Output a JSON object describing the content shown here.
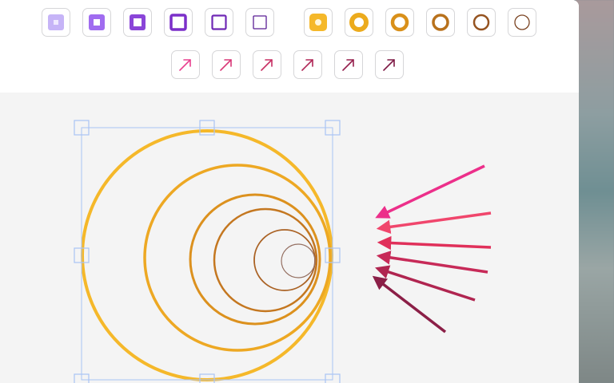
{
  "toolbar": {
    "square_tools": [
      {
        "name": "square-stroke-1",
        "fill": "#c6b4f7",
        "inner": "#efe9ff",
        "stroke_weight": 1
      },
      {
        "name": "square-stroke-2",
        "fill": "#a06cf0",
        "inner": "#ffffff",
        "stroke_weight": 2
      },
      {
        "name": "square-stroke-3",
        "fill": "#8a45d8",
        "inner": "#ffffff",
        "stroke_weight": 3
      },
      {
        "name": "square-stroke-4",
        "fill": "#7b2fc9",
        "inner": "#ffffff",
        "stroke_weight": 4
      },
      {
        "name": "square-stroke-5",
        "fill": "#6f28b5",
        "inner": "#ffffff",
        "stroke_weight": 5
      },
      {
        "name": "square-stroke-6",
        "fill": "#5a1f95",
        "inner": "#ffffff",
        "stroke_weight": 6
      }
    ],
    "circle_tools": [
      {
        "name": "circle-stroke-1",
        "color": "#f5b82a",
        "stroke_weight": 1
      },
      {
        "name": "circle-stroke-2",
        "color": "#ecab1d",
        "stroke_weight": 2
      },
      {
        "name": "circle-stroke-3",
        "color": "#d9901a",
        "stroke_weight": 3
      },
      {
        "name": "circle-stroke-4",
        "color": "#b8711c",
        "stroke_weight": 4
      },
      {
        "name": "circle-stroke-5",
        "color": "#955320",
        "stroke_weight": 5
      },
      {
        "name": "circle-stroke-6",
        "color": "#7a4322",
        "stroke_weight": 6
      }
    ],
    "arrow_tools": [
      {
        "name": "arrow-1",
        "color": "#e8408f"
      },
      {
        "name": "arrow-2",
        "color": "#d93878"
      },
      {
        "name": "arrow-3",
        "color": "#c72f63"
      },
      {
        "name": "arrow-4",
        "color": "#b02656"
      },
      {
        "name": "arrow-5",
        "color": "#951f4c"
      },
      {
        "name": "arrow-6",
        "color": "#7e1a45"
      }
    ]
  },
  "canvas": {
    "selection_color": "#a9c4f5",
    "circle_colors": [
      "#f5b82a",
      "#eda823",
      "#dc911e",
      "#c47720",
      "#aa6224",
      "#957062"
    ],
    "arrow_colors": [
      "#ec2f8a",
      "#f0466c",
      "#e0305a",
      "#c72a58",
      "#b02550",
      "#8b1f47"
    ]
  }
}
